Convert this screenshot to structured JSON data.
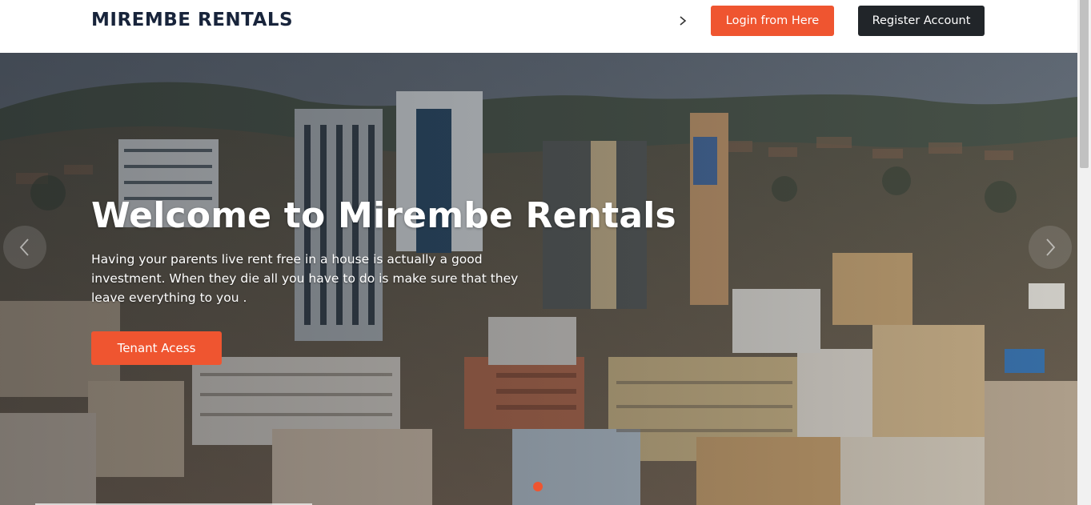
{
  "header": {
    "brand": "MIREMBE RENTALS",
    "nav_chevron_icon": "chevron-right-icon",
    "login_label": "Login from Here",
    "register_label": "Register Account"
  },
  "hero": {
    "title": "Welcome to Mirembe Rentals",
    "text": "Having your parents live rent free in a house is actually a good investment. When they die all you have to do is make sure that they leave everything to you .",
    "tenant_label": "Tenant Acess",
    "prev_icon": "chevron-left-icon",
    "next_icon": "chevron-right-icon",
    "background": "city-skyline-photo",
    "active_slide_indicator": 1
  },
  "colors": {
    "accent": "#ef5530",
    "dark": "#212529",
    "brand_text": "#18243b"
  }
}
